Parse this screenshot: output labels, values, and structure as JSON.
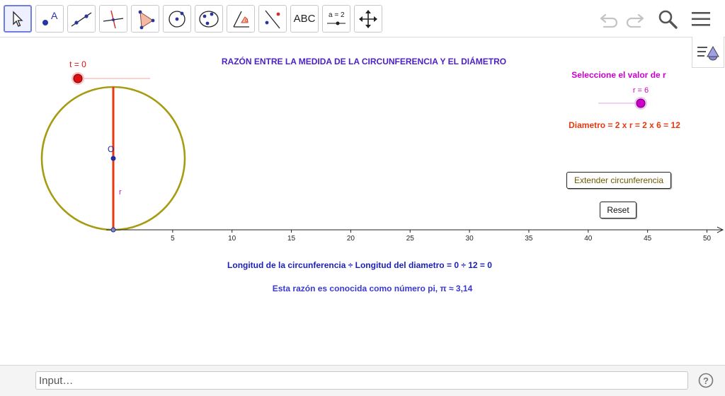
{
  "toolbar": {
    "tools": [
      {
        "name": "move-tool",
        "icon": "cursor-arrow-icon"
      },
      {
        "name": "point-tool",
        "icon": "point-icon",
        "label": "A"
      },
      {
        "name": "line-tool",
        "icon": "line-through-points-icon"
      },
      {
        "name": "perpendicular-line-tool",
        "icon": "perpendicular-line-icon"
      },
      {
        "name": "polygon-tool",
        "icon": "polygon-icon"
      },
      {
        "name": "circle-center-point-tool",
        "icon": "circle-center-icon"
      },
      {
        "name": "circle-three-points-tool",
        "icon": "ellipse-icon"
      },
      {
        "name": "angle-tool",
        "icon": "angle-icon",
        "label": "α"
      },
      {
        "name": "reflect-tool",
        "icon": "reflect-about-line-icon"
      },
      {
        "name": "text-tool",
        "icon": "text-icon",
        "label": "ABC"
      },
      {
        "name": "slider-tool",
        "icon": "slider-icon",
        "label": "a = 2"
      },
      {
        "name": "move-graphics-view-tool",
        "icon": "move-arrows-icon"
      }
    ],
    "undo_icon": "undo-icon",
    "redo_icon": "redo-icon",
    "search_icon": "search-icon",
    "menu_icon": "menu-icon"
  },
  "graphics": {
    "title": "RAZÓN ENTRE LA MEDIDA DE LA CIRCUNFERENCIA Y EL DIÁMETRO",
    "slider_t": {
      "label": "t = 0",
      "value": 0
    },
    "point_label": "O",
    "radius_label": "r",
    "select_label": "Seleccione el valor de r",
    "slider_r": {
      "label": "r = 6",
      "value": 6
    },
    "diameter_text": "Diametro = 2 x r = 2 x 6 = 12",
    "extend_button": "Extender circunferencia",
    "reset_button": "Reset",
    "axis_ticks": [
      "5",
      "10",
      "15",
      "20",
      "25",
      "30",
      "35",
      "40",
      "45",
      "50"
    ],
    "ratio_text": "Longitud de la circunferencia ÷ Longitud del diametro = 0 ÷ 12 = 0",
    "pi_text": "Esta razón es conocida como número pi,  π ≈ 3,14",
    "style_bar_icon": "style-bar-icon"
  },
  "input_bar": {
    "placeholder": "Input…",
    "help_icon": "help-icon"
  },
  "colors": {
    "title": "#4b1fc4",
    "circle": "#a59c12",
    "diameter": "#e8380d",
    "point": "#1f2aa6",
    "slider_t_point": "#dd1111",
    "slider_r_point": "#cc00cc",
    "magenta_text": "#cc00cc",
    "red_text": "#e8380d",
    "blue_text": "#1a1fb8"
  }
}
